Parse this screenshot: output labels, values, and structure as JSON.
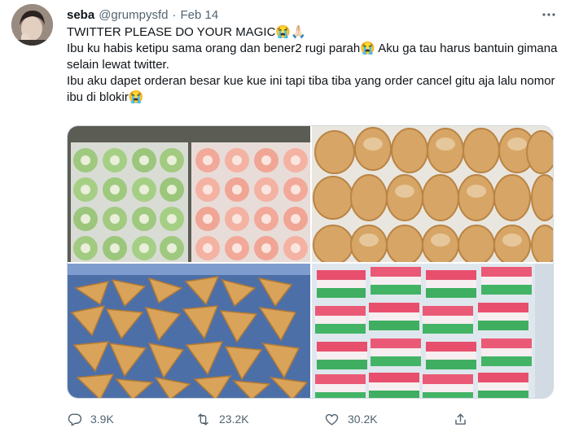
{
  "tweet": {
    "author_name": "seba",
    "handle": "@grumpysfd",
    "separator": "·",
    "date": "Feb 14",
    "lines": [
      "TWITTER PLEASE DO YOUR MAGIC😭🙏🏻",
      "Ibu ku habis ketipu sama orang dan bener2 rugi parah😭 Aku ga tau harus bantuin gimana selain lewat twitter.",
      "Ibu aku dapet orderan besar kue kue ini tapi tiba tiba yang order cancel gitu aja lalu nomor ibu di blokir😭"
    ]
  },
  "photos": [
    {
      "name": "green-pink-cakes"
    },
    {
      "name": "sugar-donuts"
    },
    {
      "name": "fried-pastries"
    },
    {
      "name": "layered-cakes"
    }
  ],
  "actions": {
    "replies": "3.9K",
    "retweets": "23.2K",
    "likes": "30.2K"
  },
  "icons": [
    "avatar",
    "more-icon",
    "reply-icon",
    "retweet-icon",
    "like-icon",
    "share-icon"
  ],
  "colors": {
    "text": "#0f1419",
    "secondary": "#536471",
    "border": "#cfd9de"
  }
}
